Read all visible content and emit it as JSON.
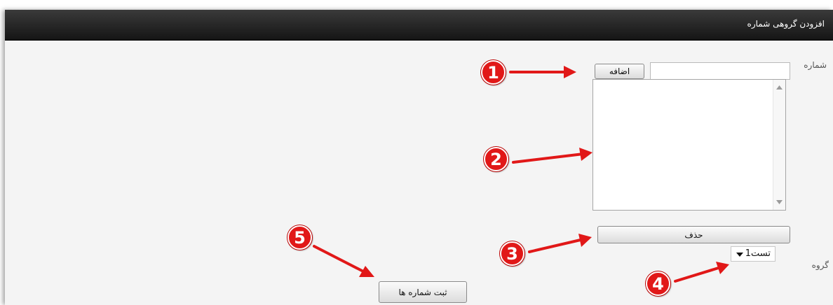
{
  "dialog": {
    "title": "افزودن گروهی شماره"
  },
  "form": {
    "number_label": "شماره",
    "number_value": "",
    "add_button_label": "اضافه",
    "delete_button_label": "حذف",
    "group_label": "گروه",
    "group_selected": "تست1",
    "submit_button_label": "ثبت شماره ها"
  },
  "annotations": {
    "markers": [
      "1",
      "2",
      "3",
      "4",
      "5"
    ],
    "color": "#e11818"
  }
}
